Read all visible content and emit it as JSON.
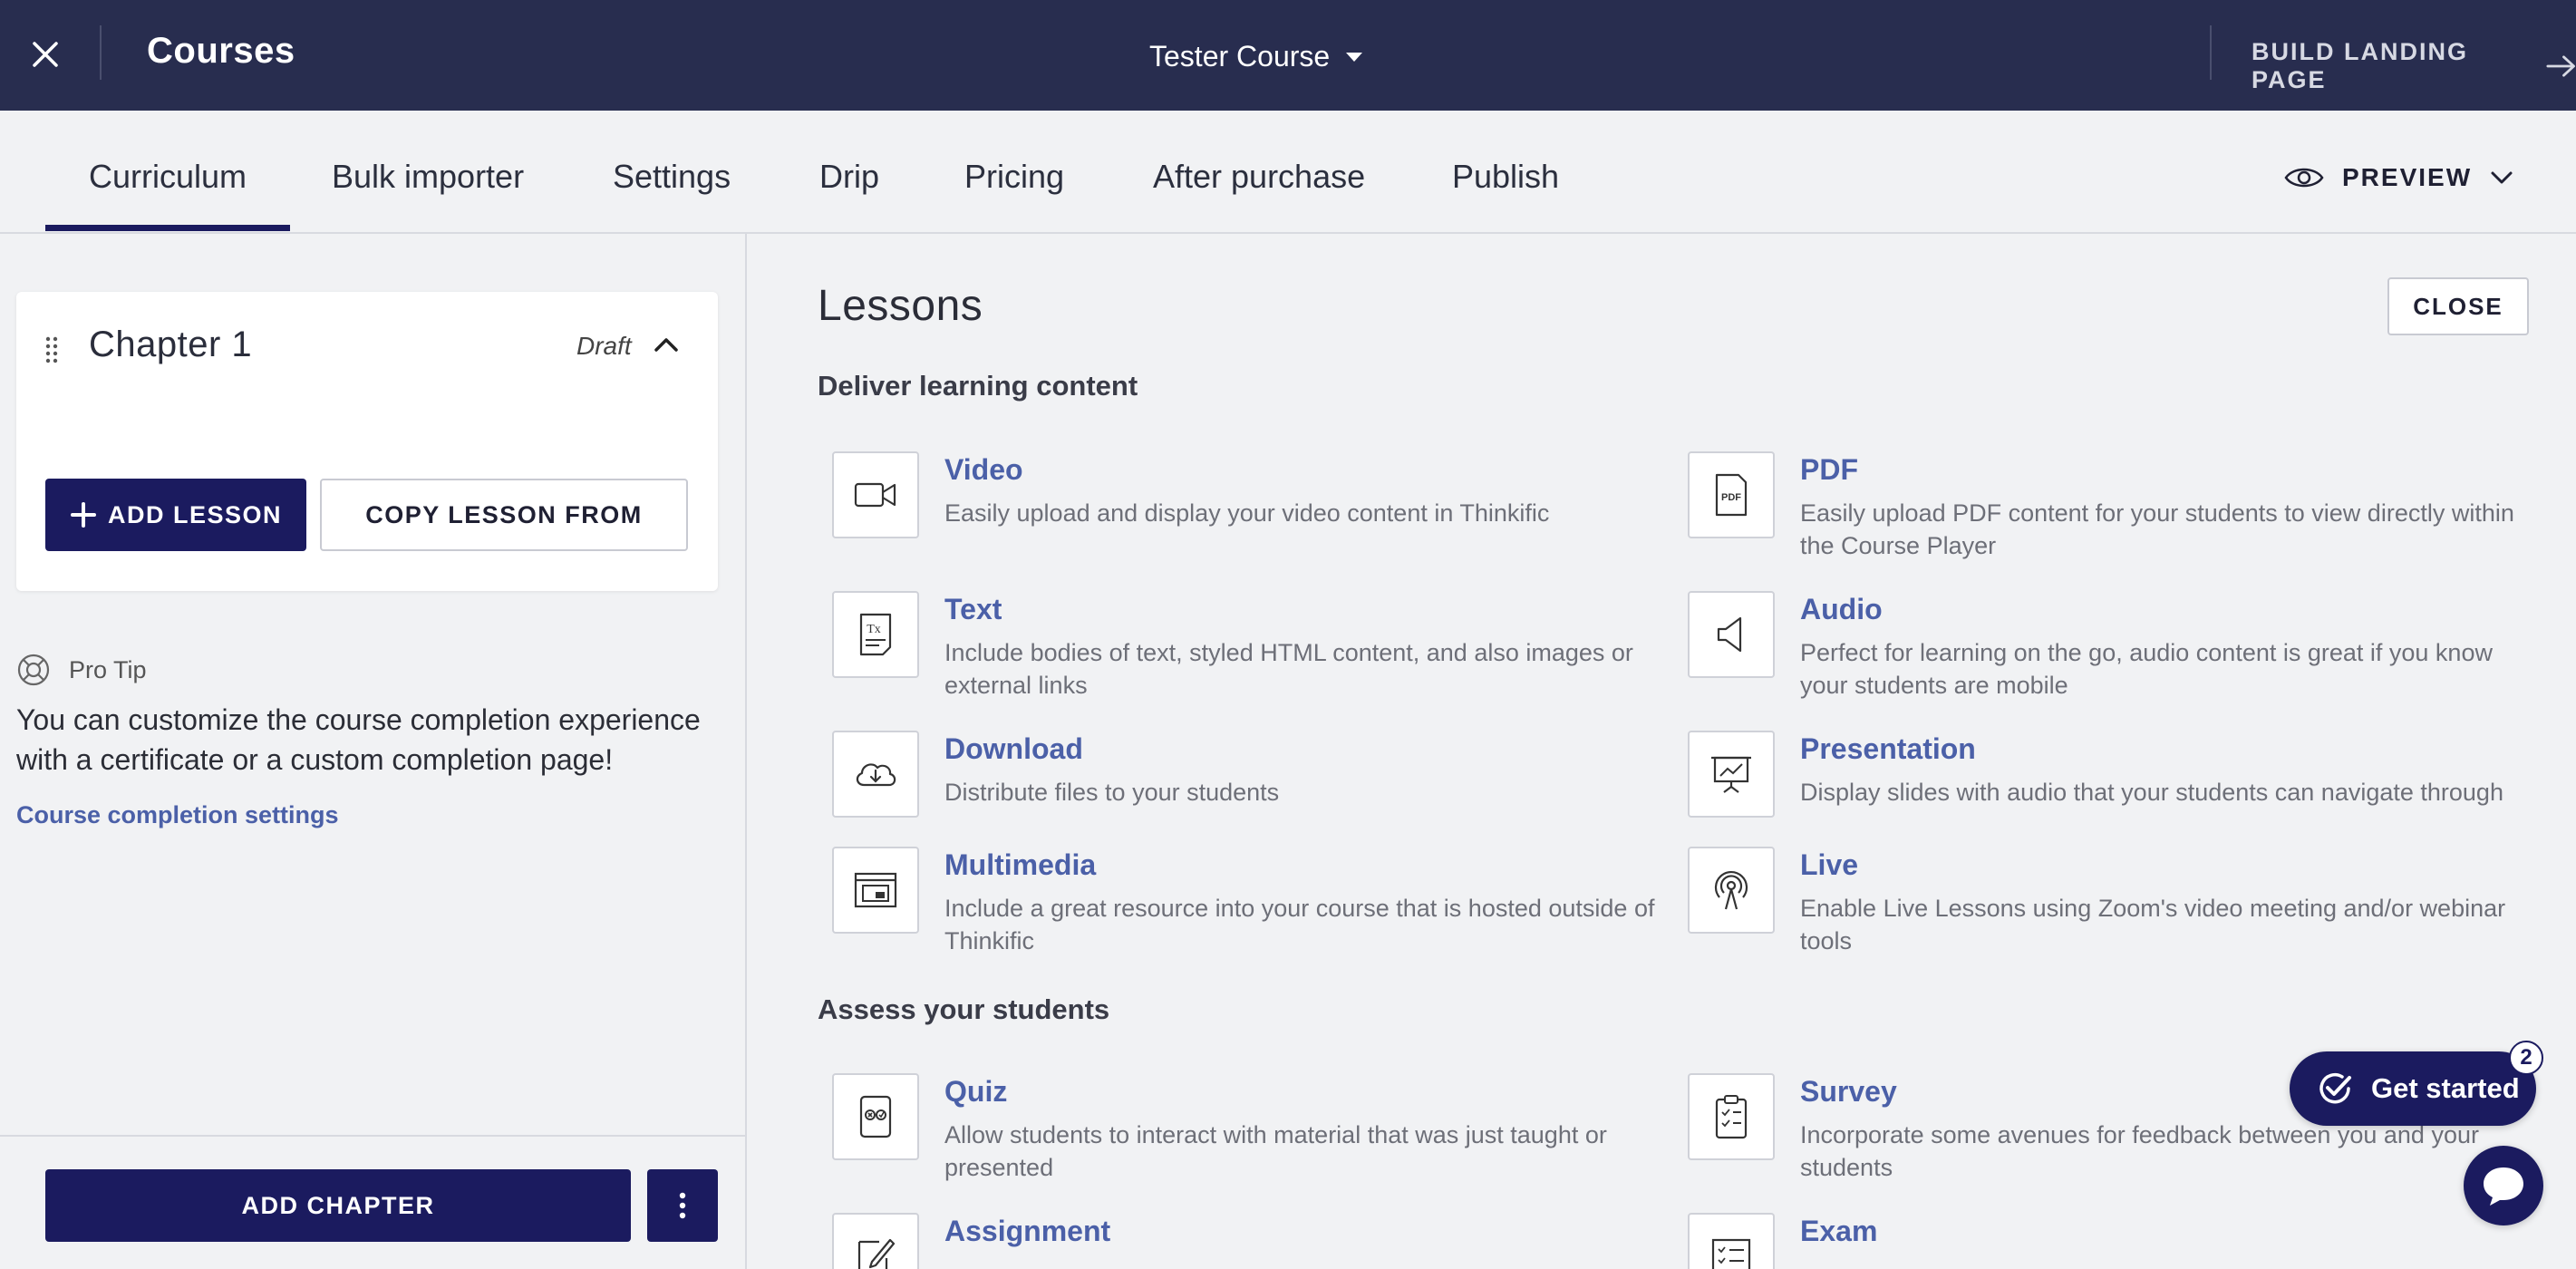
{
  "topbar": {
    "title": "Courses",
    "course_name": "Tester Course",
    "build_landing_label": "BUILD LANDING PAGE"
  },
  "tabs": [
    "Curriculum",
    "Bulk importer",
    "Settings",
    "Drip",
    "Pricing",
    "After purchase",
    "Publish"
  ],
  "active_tab": "Curriculum",
  "preview_label": "PREVIEW",
  "chapter": {
    "title": "Chapter 1",
    "status": "Draft",
    "add_lesson_label": "ADD LESSON",
    "copy_lesson_label": "COPY LESSON FROM"
  },
  "pro_tip": {
    "heading": "Pro Tip",
    "text": "You can customize the course completion experience with a certificate or a custom completion page!",
    "link": "Course completion settings"
  },
  "footer": {
    "add_chapter_label": "ADD CHAPTER"
  },
  "lessons_panel": {
    "title": "Lessons",
    "close_label": "CLOSE",
    "sections": [
      {
        "heading": "Deliver learning content",
        "items": [
          {
            "name": "Video",
            "desc": "Easily upload and display your video content in Thinkific",
            "icon": "video-camera-icon"
          },
          {
            "name": "PDF",
            "desc": "Easily upload PDF content for your students to view directly within the Course Player",
            "icon": "pdf-icon"
          },
          {
            "name": "Text",
            "desc": "Include bodies of text, styled HTML content, and also images or external links",
            "icon": "text-doc-icon"
          },
          {
            "name": "Audio",
            "desc": "Perfect for learning on the go, audio content is great if you know your students are mobile",
            "icon": "speaker-icon"
          },
          {
            "name": "Download",
            "desc": "Distribute files to your students",
            "icon": "cloud-download-icon"
          },
          {
            "name": "Presentation",
            "desc": "Display slides with audio that your students can navigate through",
            "icon": "presentation-icon"
          },
          {
            "name": "Multimedia",
            "desc": "Include a great resource into your course that is hosted outside of Thinkific",
            "icon": "multimedia-icon"
          },
          {
            "name": "Live",
            "desc": "Enable Live Lessons using Zoom's video meeting and/or webinar tools",
            "icon": "broadcast-icon"
          }
        ]
      },
      {
        "heading": "Assess your students",
        "items": [
          {
            "name": "Quiz",
            "desc": "Allow students to interact with material that was just taught or presented",
            "icon": "quiz-icon"
          },
          {
            "name": "Survey",
            "desc": "Incorporate some avenues for feedback between you and your students",
            "icon": "clipboard-checklist-icon"
          },
          {
            "name": "Assignment",
            "desc": "",
            "icon": "pencil-paper-icon"
          },
          {
            "name": "Exam",
            "desc": "",
            "icon": "exam-list-icon"
          }
        ]
      }
    ]
  },
  "get_started": {
    "label": "Get started",
    "badge": "2"
  },
  "colors": {
    "topbar_bg": "#282d4f",
    "primary_navy": "#1b1b5f",
    "link_blue": "#4b60a8",
    "page_bg": "#f1f2f4"
  }
}
